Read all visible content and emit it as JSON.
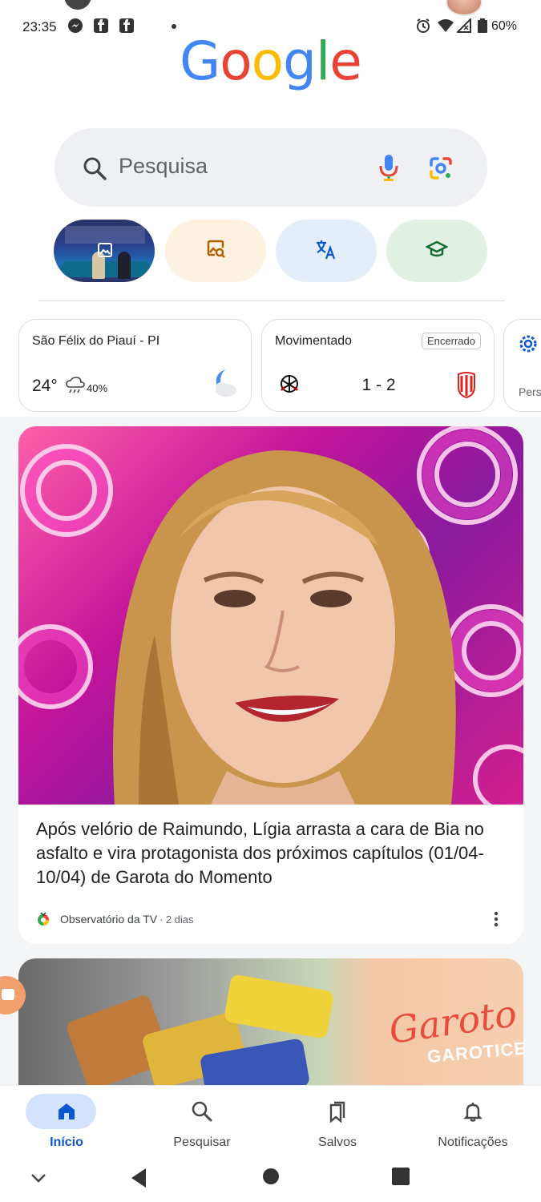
{
  "status_bar": {
    "time": "23:35",
    "battery": "60%",
    "icons": [
      "messenger-icon",
      "facebook-icon",
      "facebook-icon",
      "alarm-icon",
      "wifi-icon",
      "signal-icon",
      "battery-icon"
    ]
  },
  "logo": {
    "letters": [
      "G",
      "o",
      "o",
      "g",
      "l",
      "e"
    ],
    "colors": [
      "#4285F4",
      "#EA4335",
      "#FBBC05",
      "#4285F4",
      "#34A853",
      "#EA4335"
    ]
  },
  "search": {
    "placeholder": "Pesquisa"
  },
  "shortcuts": {
    "items": [
      "image-thumbnail",
      "lens-image-search-icon",
      "translate-icon",
      "school-cap-icon"
    ]
  },
  "weather_card": {
    "location": "São Félix do Piauí - PI",
    "temperature": "24°",
    "precipitation": "40%"
  },
  "sports_card": {
    "label": "Movimentado",
    "status": "Encerrado",
    "score": "1 - 2"
  },
  "settings_card": {
    "label": "Pers"
  },
  "news": {
    "title": "Após velório de Raimundo, Lígia arrasta a cara de Bia no asfalto e vira protagonista dos próximos capítulos (01/04-10/04) de Garota do Momento",
    "source": "Observatório da TV",
    "separator": "·",
    "time": "2 dias"
  },
  "news2": {
    "brand": "Garoto",
    "sub": "GAROTICES"
  },
  "bottom_nav": {
    "items": [
      {
        "label": "Início",
        "icon": "home-icon",
        "active": true
      },
      {
        "label": "Pesquisar",
        "icon": "search-icon",
        "active": false
      },
      {
        "label": "Salvos",
        "icon": "bookmarks-icon",
        "active": false
      },
      {
        "label": "Notificações",
        "icon": "bell-icon",
        "active": false
      }
    ]
  },
  "colors": {
    "accent": "#0b57d0",
    "search_bg": "#eef0f3",
    "active_pill": "#d3e3fd"
  }
}
